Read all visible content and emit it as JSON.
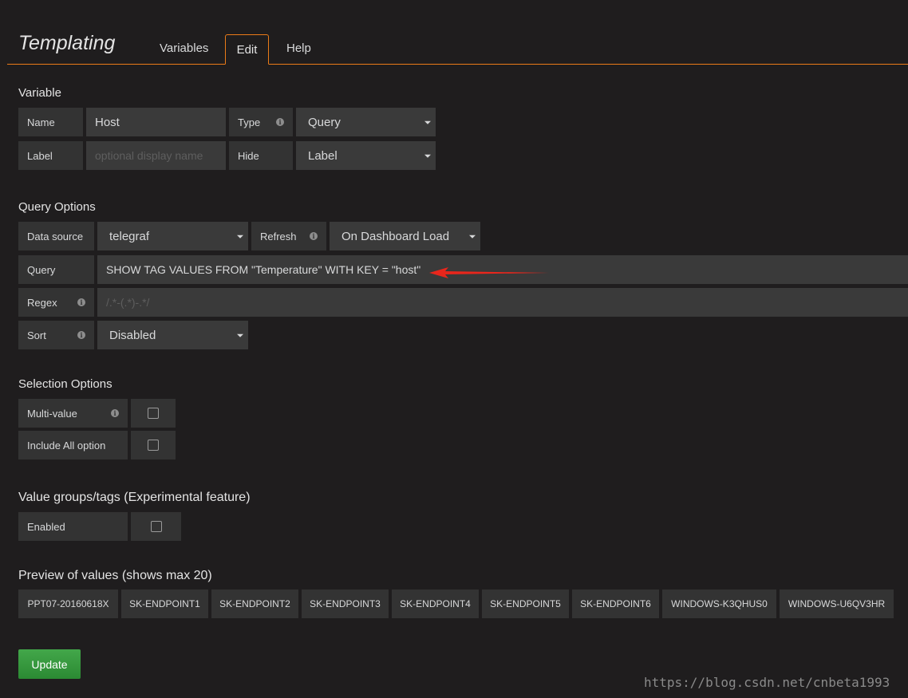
{
  "header": {
    "title": "Templating",
    "tabs": {
      "variables": "Variables",
      "edit": "Edit",
      "help": "Help"
    }
  },
  "variable": {
    "section_title": "Variable",
    "name_label": "Name",
    "name_value": "Host",
    "type_label": "Type",
    "type_value": "Query",
    "label_label": "Label",
    "label_placeholder": "optional display name",
    "hide_label": "Hide",
    "hide_value": "Label"
  },
  "query_options": {
    "section_title": "Query Options",
    "datasource_label": "Data source",
    "datasource_value": "telegraf",
    "refresh_label": "Refresh",
    "refresh_value": "On Dashboard Load",
    "query_label": "Query",
    "query_value": "SHOW TAG VALUES FROM \"Temperature\" WITH KEY = \"host\"",
    "regex_label": "Regex",
    "regex_placeholder": "/.*-(.*)-.*/",
    "sort_label": "Sort",
    "sort_value": "Disabled"
  },
  "selection_options": {
    "section_title": "Selection Options",
    "multi_value_label": "Multi-value",
    "include_all_label": "Include All option"
  },
  "value_groups": {
    "section_title": "Value groups/tags (Experimental feature)",
    "enabled_label": "Enabled"
  },
  "preview": {
    "section_title": "Preview of values (shows max 20)",
    "values": [
      "PPT07-20160618X",
      "SK-ENDPOINT1",
      "SK-ENDPOINT2",
      "SK-ENDPOINT3",
      "SK-ENDPOINT4",
      "SK-ENDPOINT5",
      "SK-ENDPOINT6",
      "WINDOWS-K3QHUS0",
      "WINDOWS-U6QV3HR"
    ]
  },
  "update_label": "Update",
  "watermark": "https://blog.csdn.net/cnbeta1993",
  "colors": {
    "accent": "#eb7b18",
    "annotation_arrow": "#e8261c",
    "update_button": "#2b8a33"
  }
}
